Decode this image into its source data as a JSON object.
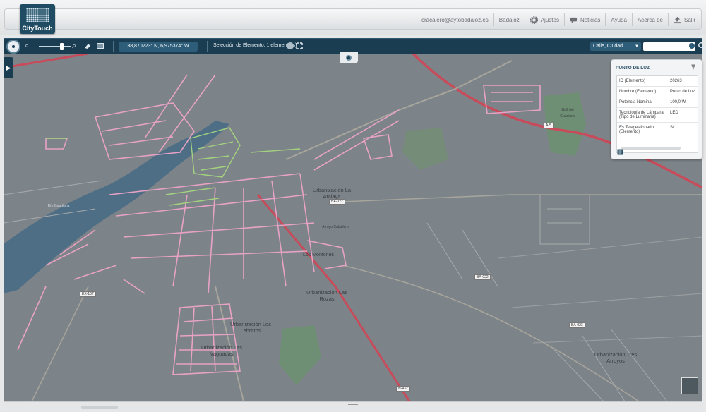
{
  "header": {
    "logo_text": "CityTouch",
    "nav": {
      "user_email": "cracalero@aytobadajoz.es",
      "city": "Badajoz",
      "settings": "Ajustes",
      "news": "Noticias",
      "help": "Ayuda",
      "about": "Acerca de",
      "logout": "Salir"
    }
  },
  "toolbar": {
    "coordinates": "38,870223° N,  6,975374° W",
    "selection": "Selección de Elemento:  1 elemento(s)",
    "search_type": "Calle, Ciudad",
    "search_value": ""
  },
  "info_panel": {
    "title": "PUNTO DE LUZ",
    "rows": [
      {
        "key": "ID (Elemento)",
        "value": "20263"
      },
      {
        "key": "Nombre  (Elemento)",
        "value": "Punto de Luz"
      },
      {
        "key": "Potencia Nominal",
        "value": "100,0 W"
      },
      {
        "key": "Tecnología de Lámpara (Tipo de Luminaria)",
        "value": "LED"
      },
      {
        "key": "Es Telegestionado (Elemento)",
        "value": "Sí"
      }
    ]
  },
  "map": {
    "labels": {
      "la_atalaya": "Urbanización La Atalaya",
      "las_rozas": "Urbanización Las Rozas",
      "los_lebratos": "Urbanización Los Lebratos",
      "las_vaguadas": "Urbanización Las Vaguadas",
      "tres_arroyos": "Urbanización Tres Arroyos",
      "los_montones": "Los Montones",
      "rio_guadiana": "Río Guadiana",
      "arroyo_caballero": "Arroyo Caballero",
      "golf": "Golf del Guadiana"
    },
    "shields": {
      "ba022_a": "BA-022",
      "ba022_b": "BA-022",
      "ba023": "BA-023",
      "ex107": "EX-107",
      "a5": "A-5",
      "n432": "N-432"
    }
  }
}
